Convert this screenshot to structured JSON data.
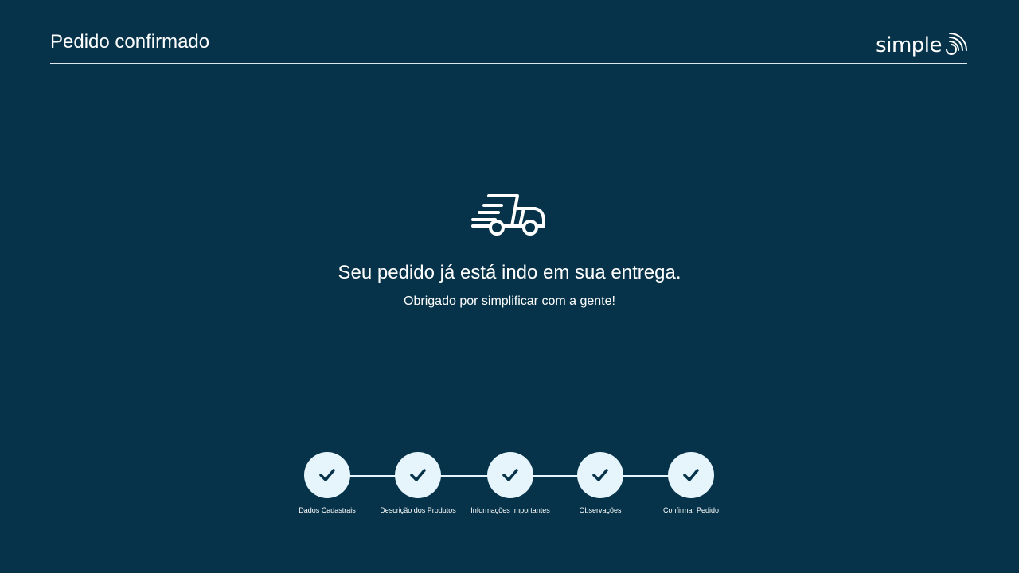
{
  "header": {
    "title": "Pedido confirmado",
    "logo_text": "simple",
    "logo_icon": "simple-logo-mark"
  },
  "hero": {
    "icon": "delivery-truck-icon",
    "title": "Seu pedido já está indo em sua entrega.",
    "subtitle": "Obrigado por simplificar com a gente!"
  },
  "steps": [
    {
      "label": "Dados Cadastrais",
      "status": "completed",
      "icon": "check-icon"
    },
    {
      "label": "Descrição dos Produtos",
      "status": "completed",
      "icon": "check-icon"
    },
    {
      "label": "Informações Importantes",
      "status": "completed",
      "icon": "check-icon"
    },
    {
      "label": "Observações",
      "status": "completed",
      "icon": "check-icon"
    },
    {
      "label": "Confirmar Pedido",
      "status": "completed",
      "icon": "check-icon"
    }
  ],
  "colors": {
    "background": "#063349",
    "text": "#ffffff",
    "step_fill": "#e6f5fb",
    "check": "#063349"
  }
}
